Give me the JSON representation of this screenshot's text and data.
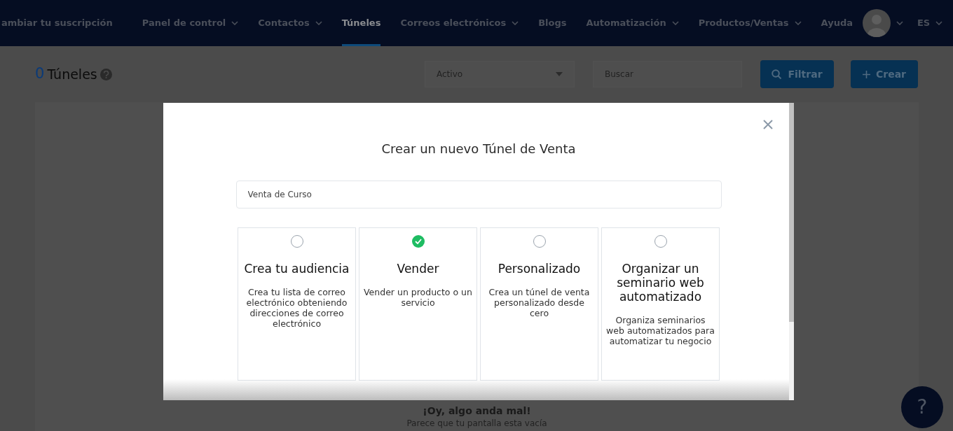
{
  "nav": {
    "items": [
      {
        "label": "ambiar tu suscripción",
        "dropdown": false,
        "selected": false
      },
      {
        "label": "Panel de control",
        "dropdown": true,
        "selected": false
      },
      {
        "label": "Contactos",
        "dropdown": true,
        "selected": false
      },
      {
        "label": "Túneles",
        "dropdown": false,
        "selected": true
      },
      {
        "label": "Correos electrónicos",
        "dropdown": true,
        "selected": false
      },
      {
        "label": "Blogs",
        "dropdown": false,
        "selected": false
      },
      {
        "label": "Automatización",
        "dropdown": true,
        "selected": false
      },
      {
        "label": "Productos/Ventas",
        "dropdown": true,
        "selected": false
      },
      {
        "label": "Ayuda",
        "dropdown": false,
        "selected": false
      }
    ],
    "language": "ES"
  },
  "header": {
    "count": "0",
    "title": "Túneles",
    "status_select": "Activo",
    "search": {
      "placeholder": "Buscar"
    },
    "filter_button": "Filtrar",
    "create_button": "Crear"
  },
  "empty_state": {
    "title": "¡Oy, algo anda mal!",
    "message": "Parece que tu pantalla esta vacía"
  },
  "modal": {
    "title": "Crear un nuevo Túnel de Venta",
    "name_field": {
      "value": "Venta de Curso"
    },
    "options": [
      {
        "title": "Crea tu audiencia",
        "description": "Crea tu lista de correo electrónico obteniendo direcciones de correo electrónico",
        "selected": false
      },
      {
        "title": "Vender",
        "description": "Vender un producto o un servicio",
        "selected": true
      },
      {
        "title": "Personalizado",
        "description": "Crea un túnel de venta personalizado desde cero",
        "selected": false
      },
      {
        "title": "Organizar un seminario web automatizado",
        "description": "Organiza seminarios web automatizados para automatizar tu negocio",
        "selected": false
      }
    ]
  },
  "help_button": "?"
}
